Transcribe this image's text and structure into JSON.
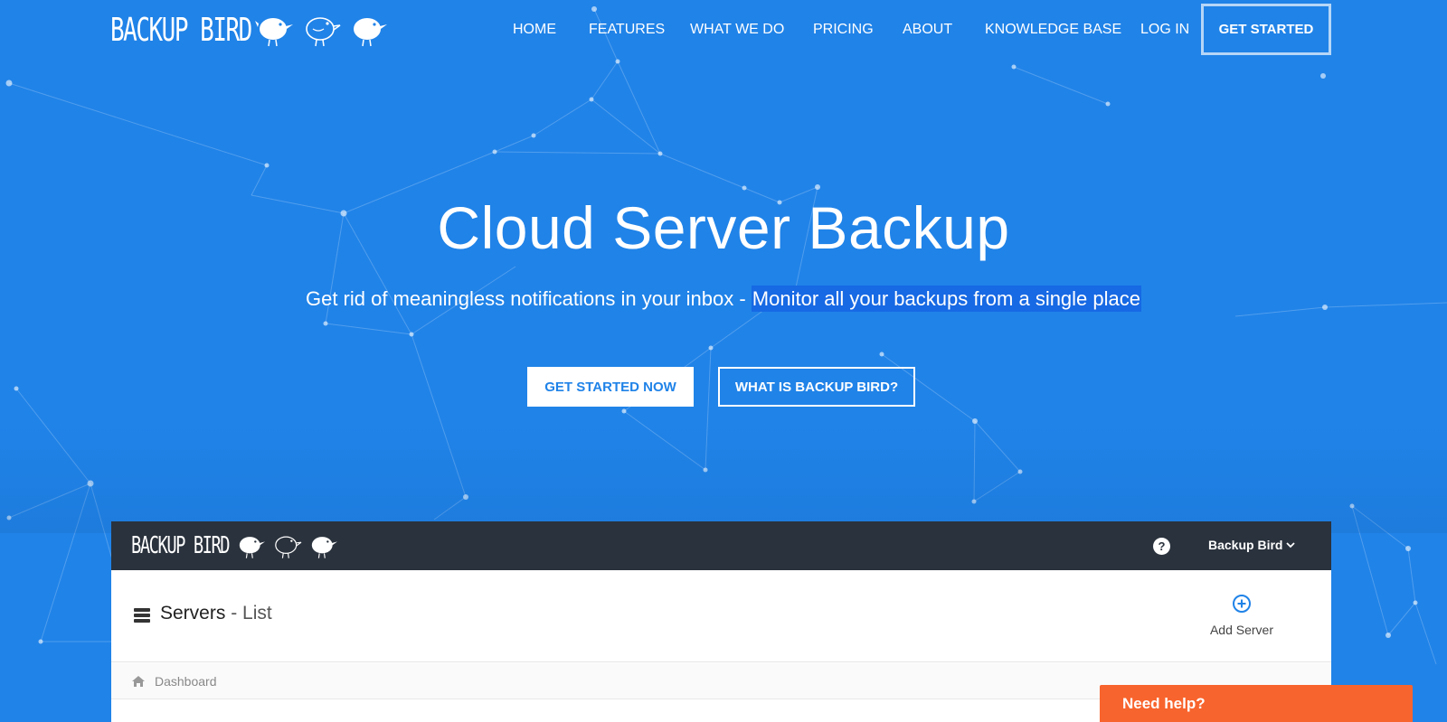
{
  "brand": {
    "name": "BACKUP BIRD"
  },
  "nav": {
    "items": [
      {
        "label": "HOME"
      },
      {
        "label": "FEATURES"
      },
      {
        "label": "WHAT WE DO"
      },
      {
        "label": "PRICING"
      },
      {
        "label": "ABOUT"
      },
      {
        "label": "KNOWLEDGE BASE"
      },
      {
        "label": "LOG IN"
      }
    ],
    "cta_label": "GET STARTED"
  },
  "hero": {
    "title": "Cloud Server Backup",
    "subtitle_plain": "Get rid of meaningless notifications in your inbox - ",
    "subtitle_highlight": "Monitor all your backups from a single place",
    "primary_button": "GET STARTED NOW",
    "secondary_button": "WHAT IS BACKUP BIRD?"
  },
  "app_preview": {
    "brand": "BACKUP BIRD",
    "help_icon": "question-circle-icon",
    "user_menu_label": "Backup Bird",
    "page_title": "Servers",
    "page_subtitle": " - List",
    "add_button_label": "Add Server",
    "breadcrumb": "Dashboard"
  },
  "chat": {
    "label": "Need help?"
  },
  "colors": {
    "background": "#2083e8",
    "highlight": "#1769e4",
    "app_bar": "#2a323d",
    "chat": "#f8642d",
    "accent_icon": "#2083e8"
  }
}
